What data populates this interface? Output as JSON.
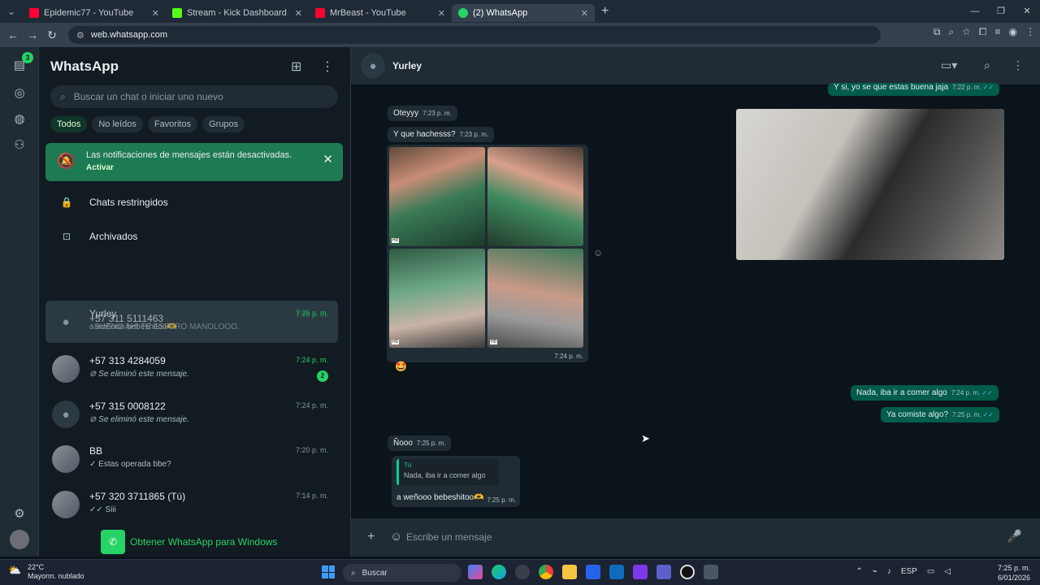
{
  "browser": {
    "tabs": [
      {
        "title": "Epidemic77 - YouTube",
        "favicon_color": "#ff0033",
        "active": false
      },
      {
        "title": "Stream - Kick Dashboard",
        "favicon_color": "#53fc18",
        "active": false
      },
      {
        "title": "MrBeast - YouTube",
        "favicon_color": "#ff0033",
        "active": false
      },
      {
        "title": "(2) WhatsApp",
        "favicon_color": "#25d366",
        "active": true
      }
    ],
    "url": "web.whatsapp.com"
  },
  "rail": {
    "chats_badge": "3"
  },
  "sidebar": {
    "title": "WhatsApp",
    "search_placeholder": "Buscar un chat o iniciar uno nuevo",
    "filters": [
      "Todos",
      "No leídos",
      "Favoritos",
      "Grupos"
    ],
    "notice": {
      "text": "Las notificaciones de mensajes están desactivadas.",
      "action": "Activar"
    },
    "restricted": "Chats restringidos",
    "archived": "Archivados",
    "chats": [
      {
        "name": "Yurley",
        "preview": "a weñooo bebeshitoo🫶",
        "time": "7:25 p. m.",
        "overlay_name": "+57 311 5111463",
        "overlay_preview": "BUENO AHI TE ESPERO MANOLOOO.",
        "overlay_time": "7:26 p. m."
      },
      {
        "name": "+57 313 4284059",
        "preview": "Se eliminó este mensaje.",
        "time": "7:24 p. m.",
        "unread": "2"
      },
      {
        "name": "+57 315 0008122",
        "preview": "Se eliminó este mensaje.",
        "time": "7:24 p. m."
      },
      {
        "name": "BB",
        "preview": "✓ Estas operada bbe?",
        "time": "7:20 p. m."
      },
      {
        "name": "+57 320 3711865 (Tú)",
        "preview": "✓✓ Siii",
        "time": "7:14 p. m."
      }
    ],
    "get_windows": "Obtener WhatsApp para Windows"
  },
  "conversation": {
    "contact": "Yurley",
    "messages": {
      "top_out": "Y si, yo se que estas buena jaja",
      "top_out_time": "7:22 p. m.",
      "m1": "Oteyyy",
      "m1_time": "7:23 p. m.",
      "m2": "Y que hachesss?",
      "m2_time": "7:23 p. m.",
      "photos_time": "7:24 p. m.",
      "photo_badge": "HD",
      "reaction": "🤩",
      "o1": "Nada, iba ir a comer algo",
      "o1_time": "7:24 p. m.",
      "o2": "Ya comiste algo?",
      "o2_time": "7:25 p. m.",
      "m3": "Ñooo",
      "m3_time": "7:25 p. m.",
      "reply_author": "Tú",
      "reply_quote": "Nada, iba ir a comer algo",
      "reply_text": "a weñooo bebeshitoo🫶",
      "reply_time": "7:25 p. m."
    },
    "composer_placeholder": "Escribe un mensaje"
  },
  "taskbar": {
    "temp": "22°C",
    "weather": "Mayorm. nublado",
    "search": "Buscar",
    "lang": "ESP",
    "time": "7:25 p. m.",
    "date": "6/01/2026"
  }
}
